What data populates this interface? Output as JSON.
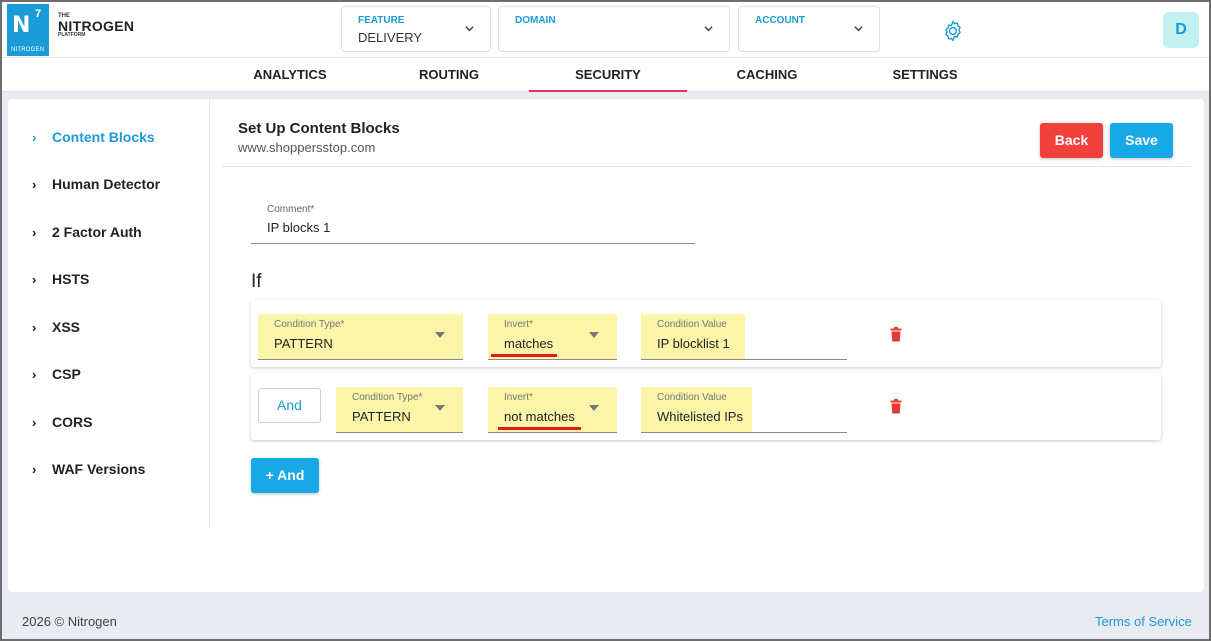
{
  "brand": {
    "logo_letter": "N",
    "logo_sup": "7",
    "logo_small": "NITROGEN",
    "the": "THE",
    "name": "NITROGEN",
    "platform": "PLATFORM"
  },
  "selectors": {
    "feature": {
      "label": "FEATURE",
      "value": "DELIVERY"
    },
    "domain": {
      "label": "DOMAIN",
      "value": ""
    },
    "account": {
      "label": "ACCOUNT",
      "value": ""
    }
  },
  "user": {
    "initial": "D"
  },
  "tabs": [
    {
      "label": "ANALYTICS"
    },
    {
      "label": "ROUTING"
    },
    {
      "label": "SECURITY",
      "active": true
    },
    {
      "label": "CACHING"
    },
    {
      "label": "SETTINGS"
    }
  ],
  "sidebar": {
    "items": [
      {
        "label": "Content Blocks",
        "active": true
      },
      {
        "label": "Human Detector"
      },
      {
        "label": "2 Factor Auth"
      },
      {
        "label": "HSTS"
      },
      {
        "label": "XSS"
      },
      {
        "label": "CSP"
      },
      {
        "label": "CORS"
      },
      {
        "label": "WAF Versions"
      }
    ]
  },
  "panel": {
    "title": "Set Up Content Blocks",
    "subtitle": "www.shoppersstop.com",
    "back_label": "Back",
    "save_label": "Save"
  },
  "comment": {
    "label": "Comment*",
    "value": "IP blocks 1"
  },
  "if_label": "If",
  "conditions": [
    {
      "type_label": "Condition Type*",
      "type_value": "PATTERN",
      "invert_label": "Invert*",
      "invert_value": "matches",
      "value_label": "Condition Value",
      "value": "IP blocklist 1"
    },
    {
      "and_label": "And",
      "type_label": "Condition Type*",
      "type_value": "PATTERN",
      "invert_label": "Invert*",
      "invert_value": "not matches",
      "value_label": "Condition Value",
      "value": "Whitelisted IPs"
    }
  ],
  "add_and_label": "+ And",
  "footer": {
    "copyright": "2026 © Nitrogen",
    "terms": "Terms of Service"
  },
  "colors": {
    "accent": "#1b9bd8",
    "back": "#f2413a",
    "save": "#16a9e6",
    "highlight": "#fbf5a9",
    "active_tab_underline": "#e0335b",
    "trash": "#e53935"
  }
}
